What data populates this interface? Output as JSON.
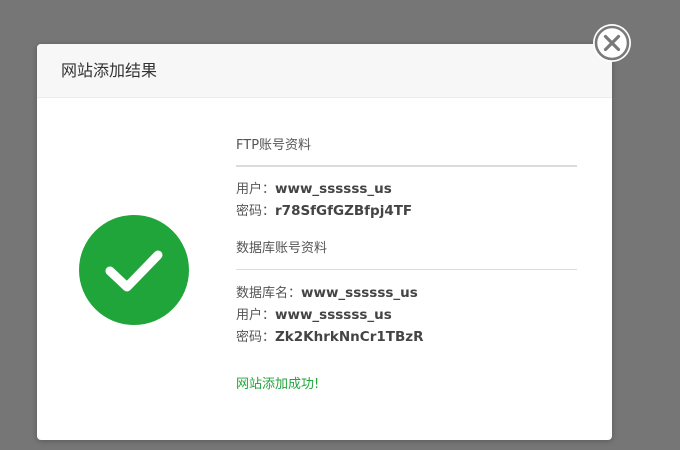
{
  "dialog": {
    "title": "网站添加结果"
  },
  "ftp": {
    "section_title": "FTP账号资料",
    "user_label": "用户：",
    "user_value": "www_ssssss_us",
    "password_label": "密码：",
    "password_value": "r78SfGfGZBfpj4TF"
  },
  "database": {
    "section_title": "数据库账号资料",
    "dbname_label": "数据库名：",
    "dbname_value": "www_ssssss_us",
    "user_label": "用户：",
    "user_value": "www_ssssss_us",
    "password_label": "密码：",
    "password_value": "Zk2KhrkNnCr1TBzR"
  },
  "status": {
    "message": "网站添加成功!"
  },
  "icons": {
    "success": "check-circle-icon",
    "close": "close-icon"
  },
  "colors": {
    "success_green": "#20a53a",
    "overlay": "#767676"
  }
}
